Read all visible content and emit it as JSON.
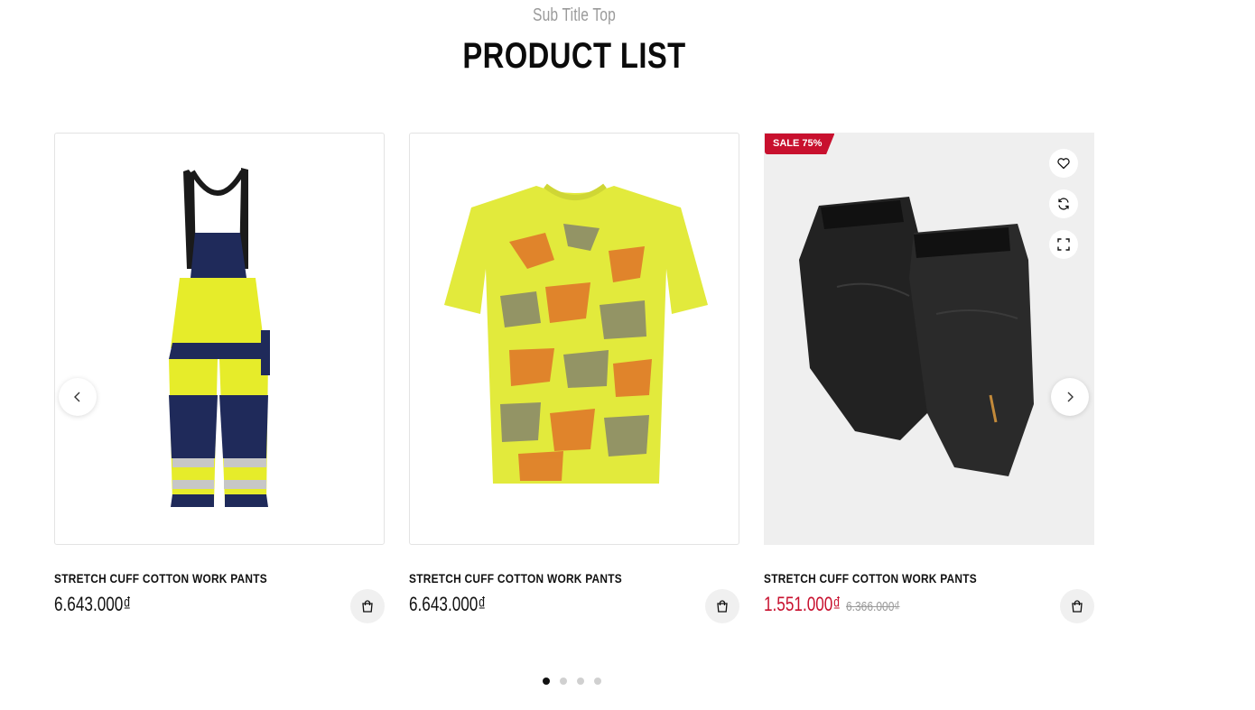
{
  "header": {
    "subtitle": "Sub Title Top",
    "title": "PRODUCT LIST"
  },
  "products": [
    {
      "name": "STRETCH CUFF COTTON WORK PANTS",
      "price": "6.643.000₫",
      "image_icon": "hi-vis-bib-overalls-image"
    },
    {
      "name": "STRETCH CUFF COTTON WORK PANTS",
      "price": "6.643.000₫",
      "image_icon": "camo-tshirt-image"
    },
    {
      "name": "STRETCH CUFF COTTON WORK PANTS",
      "price": "1.551.000₫",
      "old_price": "6.366.000₫",
      "badge": "SALE 75%",
      "image_icon": "knee-pads-image"
    }
  ],
  "actions": {
    "wishlist_icon": "heart-icon",
    "compare_icon": "refresh-icon",
    "quickview_icon": "expand-icon",
    "cart_icon": "shopping-bag-icon"
  },
  "carousel": {
    "prev_icon": "chevron-left-icon",
    "next_icon": "chevron-right-icon",
    "pages": 4,
    "active_page": 1
  },
  "colors": {
    "sale_red": "#c8102e",
    "text_dark": "#111111",
    "muted_gray": "#9a9a9a"
  }
}
